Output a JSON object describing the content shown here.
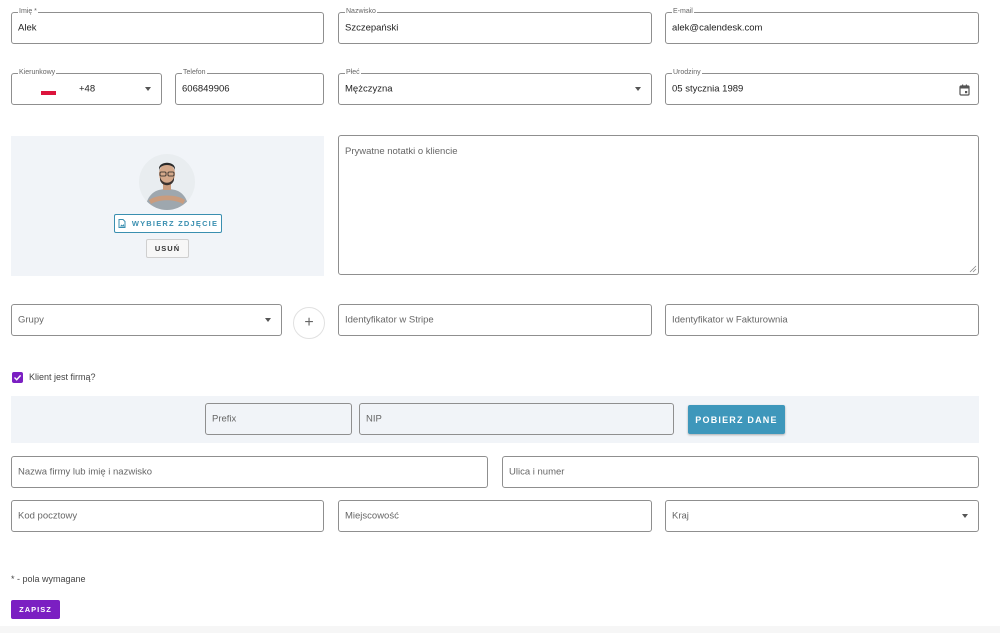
{
  "form": {
    "first_name": {
      "label": "Imię *",
      "value": "Alek"
    },
    "last_name": {
      "label": "Nazwisko",
      "value": "Szczepański"
    },
    "email": {
      "label": "E-mail",
      "value": "alek@calendesk.com"
    },
    "dial_code": {
      "label": "Kierunkowy",
      "value": "+48"
    },
    "phone": {
      "label": "Telefon",
      "value": "606849906"
    },
    "gender": {
      "label": "Płeć",
      "value": "Mężczyzna"
    },
    "birthday": {
      "label": "Urodziny",
      "value": "05 stycznia 1989"
    },
    "notes": {
      "placeholder": "Prywatne notatki o kliencie"
    },
    "groups": {
      "placeholder": "Grupy"
    },
    "stripe_id": {
      "placeholder": "Identyfikator w Stripe"
    },
    "fakturownia_id": {
      "placeholder": "Identyfikator w Fakturownia"
    }
  },
  "photo": {
    "choose_label": "WYBIERZ ZDJĘCIE",
    "remove_label": "USUŃ"
  },
  "company": {
    "checkbox_label": "Klient jest firmą?",
    "checked": true,
    "prefix_placeholder": "Prefix",
    "nip_placeholder": "NIP",
    "fetch_label": "POBIERZ DANE",
    "name_placeholder": "Nazwa firmy lub imię i nazwisko",
    "street_placeholder": "Ulica i numer",
    "postal_placeholder": "Kod pocztowy",
    "city_placeholder": "Miejscowość",
    "country_placeholder": "Kraj"
  },
  "footer": {
    "required_note": "* - pola wymagane",
    "save_label": "ZAPISZ"
  },
  "colors": {
    "accent_teal": "#3e97bb",
    "accent_purple": "#7b1fc2",
    "panel_bg": "#f1f4f8"
  }
}
